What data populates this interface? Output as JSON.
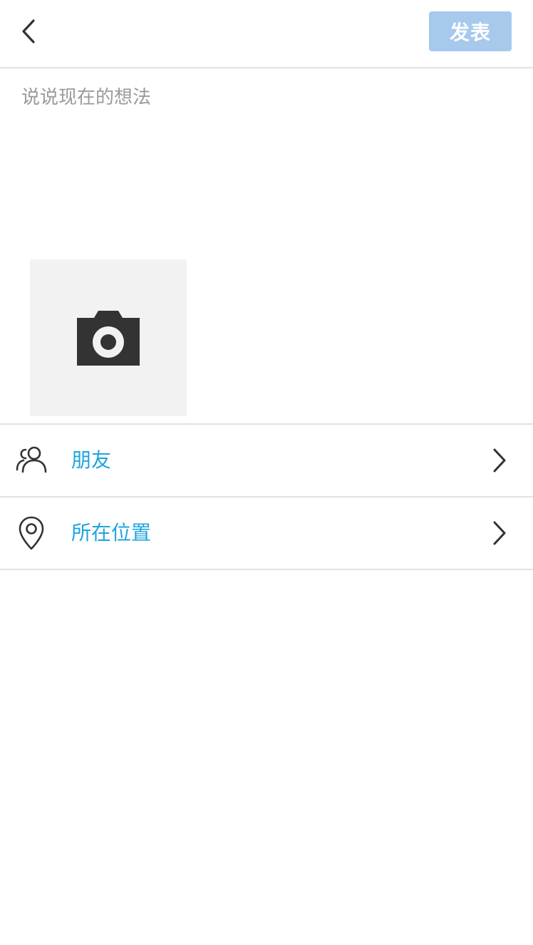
{
  "header": {
    "back_icon": "chevron-left-icon",
    "publish_label": "发表",
    "publish_color": "#a6c9ec"
  },
  "composer": {
    "placeholder": "说说现在的想法",
    "value": "",
    "add_photo_icon": "camera-icon"
  },
  "options": [
    {
      "icon": "friends-icon",
      "label": "朋友",
      "chevron": "chevron-right-icon"
    },
    {
      "icon": "location-pin-icon",
      "label": "所在位置",
      "chevron": "chevron-right-icon"
    }
  ],
  "colors": {
    "accent": "#1ea5de",
    "divider": "#e2e2e2",
    "photo_tile": "#f2f2f2",
    "icon": "#333333"
  }
}
